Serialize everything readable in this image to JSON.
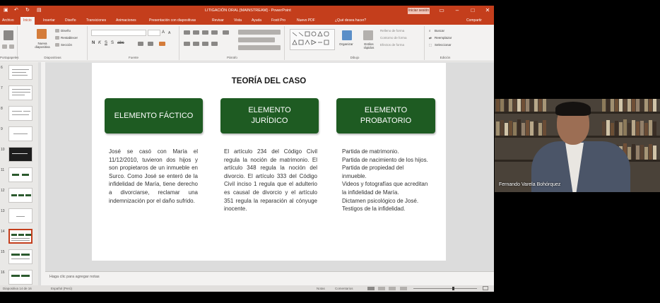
{
  "window": {
    "title": "LITIGACIÓN ORAL [MAINSTREAM] - PowerPoint",
    "signin_label": "Iniciar sesión",
    "qa_icons": [
      "save-icon",
      "undo-icon",
      "redo-icon",
      "start-slideshow-icon"
    ],
    "accent": "#c43e1c"
  },
  "tabs": [
    {
      "label": "Archivo"
    },
    {
      "label": "Inicio"
    },
    {
      "label": "Insertar"
    },
    {
      "label": "Diseño"
    },
    {
      "label": "Transiciones"
    },
    {
      "label": "Animaciones"
    },
    {
      "label": "Presentación con diapositivas"
    },
    {
      "label": "Revisar"
    },
    {
      "label": "Vista"
    },
    {
      "label": "Ayuda"
    },
    {
      "label": "Foxit Pro"
    },
    {
      "label": "Nuevo PDF"
    },
    {
      "label": "¿Qué desea hacer?"
    },
    {
      "label": "Compartir"
    }
  ],
  "ribbon": {
    "groups": {
      "clipboard": "Portapapeles",
      "slides": "Diapositivas",
      "font": "Fuente",
      "paragraph": "Párrafo",
      "drawing": "Dibujo",
      "editing": "Edición"
    },
    "slides_items": {
      "new_slide": "Nueva diapositiva",
      "layout": "Diseño",
      "reset": "Restablecer",
      "section": "Sección"
    },
    "drawing_items": {
      "arrange": "Organizar",
      "quick_styles": "Estilos rápidos",
      "fill": "Relleno de forma",
      "outline": "Contorno de forma",
      "effects": "Efectos de forma"
    },
    "editing_items": {
      "find": "Buscar",
      "replace": "Reemplazar",
      "select": "Seleccionar"
    }
  },
  "thumbnails": {
    "numbers": [
      "6",
      "7",
      "8",
      "9",
      "10",
      "11",
      "12",
      "13",
      "14",
      "15",
      "16"
    ],
    "selected": "14"
  },
  "slide": {
    "title": "TEORÍA DEL CASO",
    "accent": "#1e5b22",
    "boxes": [
      {
        "label": "ELEMENTO FÁCTICO"
      },
      {
        "label": "ELEMENTO JURÍDICO"
      },
      {
        "label": "ELEMENTO PROBATORIO"
      }
    ],
    "factico_text": "José se casó con María el 11/12/2010, tuvieron dos hijos y son propietaros de un inmueble en Surco. Como José se enteró de la infidelidad de María, tiene derecho a divorciarse, reclamar una indemnización por el daño sufrido.",
    "juridico_text": "El artículo 234 del Código Civil regula la noción de matrimonio. El artículo 348 regula la noción del divorcio. El artículo 333 del Código Civil inciso 1 regula que el adulterio es causal de divorcio y el artículo 351 regula la reparación al cónyuge inocente.",
    "probatorio_lines": [
      "Partida de matrimonio.",
      "Partida de nacimiento de los hijos.",
      "Partida de propiedad del inmueble.",
      "Videos y fotografías que acreditan la infidelidad de María.",
      "Dictamen psicológico de José.",
      "Testigos de la infidelidad."
    ]
  },
  "notes_placeholder": "Haga clic para agregar notas",
  "status": {
    "slide_info": "Diapositiva 14 de 16",
    "language": "Español (Perú)",
    "notes_label": "Notas",
    "comments_label": "Comentarios"
  },
  "webcam": {
    "participant_name": "Fernando Varela Bohórquez"
  }
}
